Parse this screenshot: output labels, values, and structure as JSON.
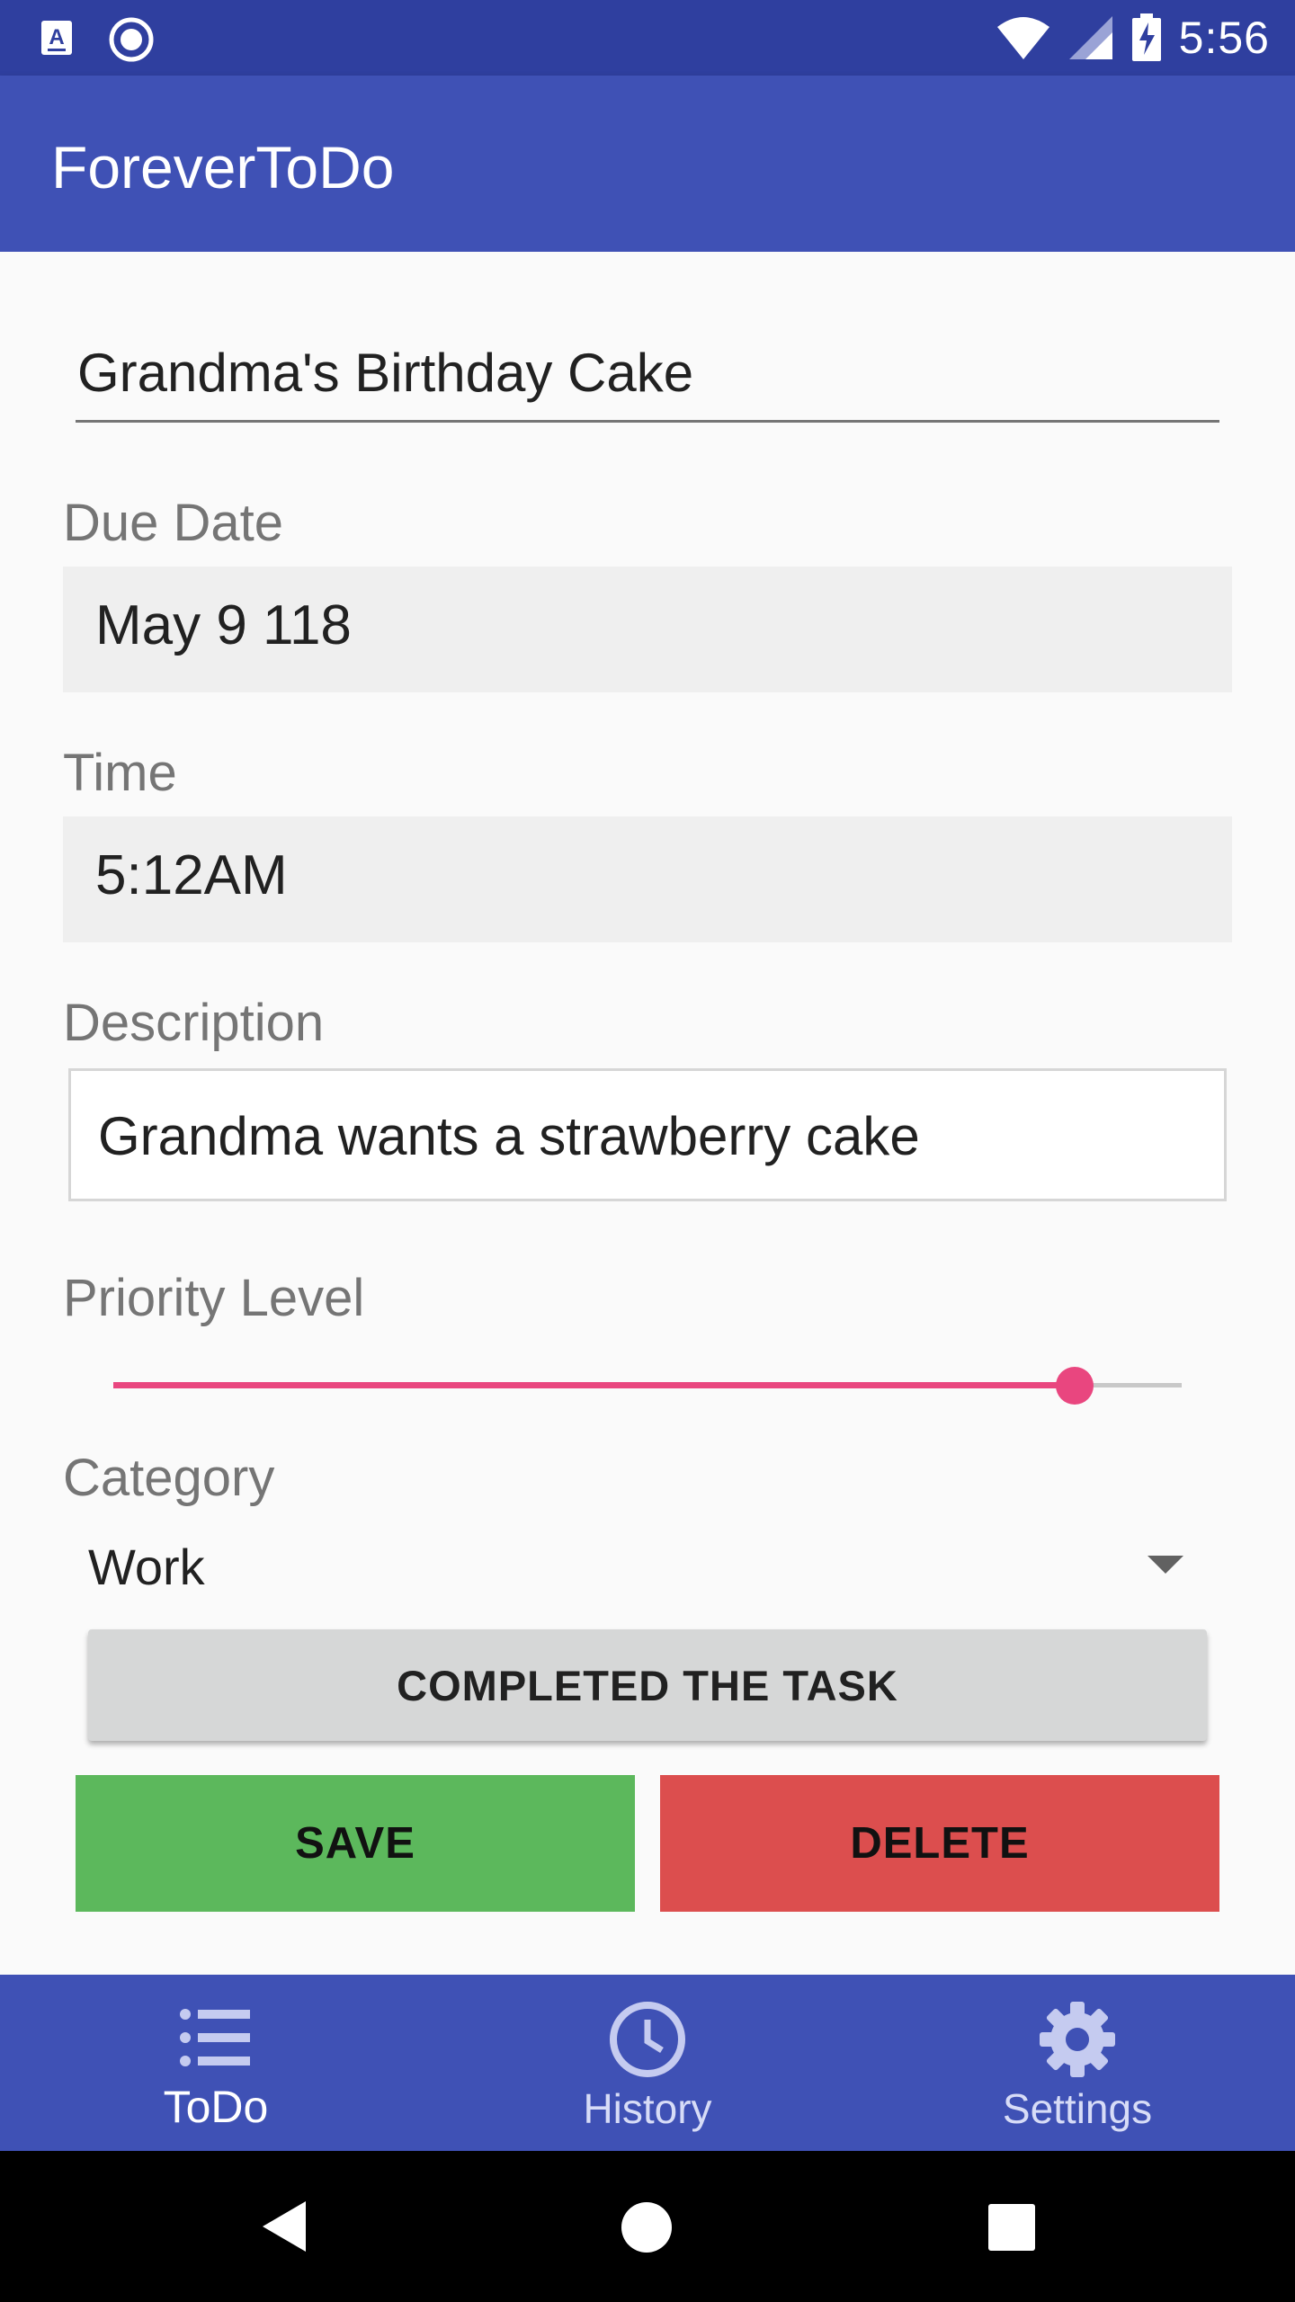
{
  "status_bar": {
    "time": "5:56",
    "icons": [
      "a-notification-icon",
      "record-icon",
      "wifi-icon",
      "signal-icon",
      "battery-charging-icon"
    ]
  },
  "app_bar": {
    "title": "ForeverToDo"
  },
  "form": {
    "task_title": "Grandma's Birthday Cake",
    "due_date": {
      "label": "Due Date",
      "value": "May 9 118"
    },
    "time": {
      "label": "Time",
      "value": "5:12AM"
    },
    "description": {
      "label": "Description",
      "value": "Grandma wants a strawberry cake"
    },
    "priority": {
      "label": "Priority Level",
      "level_fraction": 0.9
    },
    "category": {
      "label": "Category",
      "value": "Work"
    },
    "completed_label": "COMPLETED THE TASK",
    "save_label": "SAVE",
    "delete_label": "DELETE"
  },
  "colors": {
    "app_bar": "#3f51b5",
    "status_bar": "#2f3f9f",
    "accent": "#e9467f",
    "save": "#5cb85c",
    "delete": "#dc4e4e"
  },
  "bottom_nav": {
    "items": [
      {
        "label": "ToDo",
        "icon": "list-icon",
        "active": true
      },
      {
        "label": "History",
        "icon": "clock-icon",
        "active": false
      },
      {
        "label": "Settings",
        "icon": "gear-icon",
        "active": false
      }
    ]
  },
  "system_nav": {
    "icons": [
      "back-icon",
      "home-icon",
      "recents-icon"
    ]
  }
}
